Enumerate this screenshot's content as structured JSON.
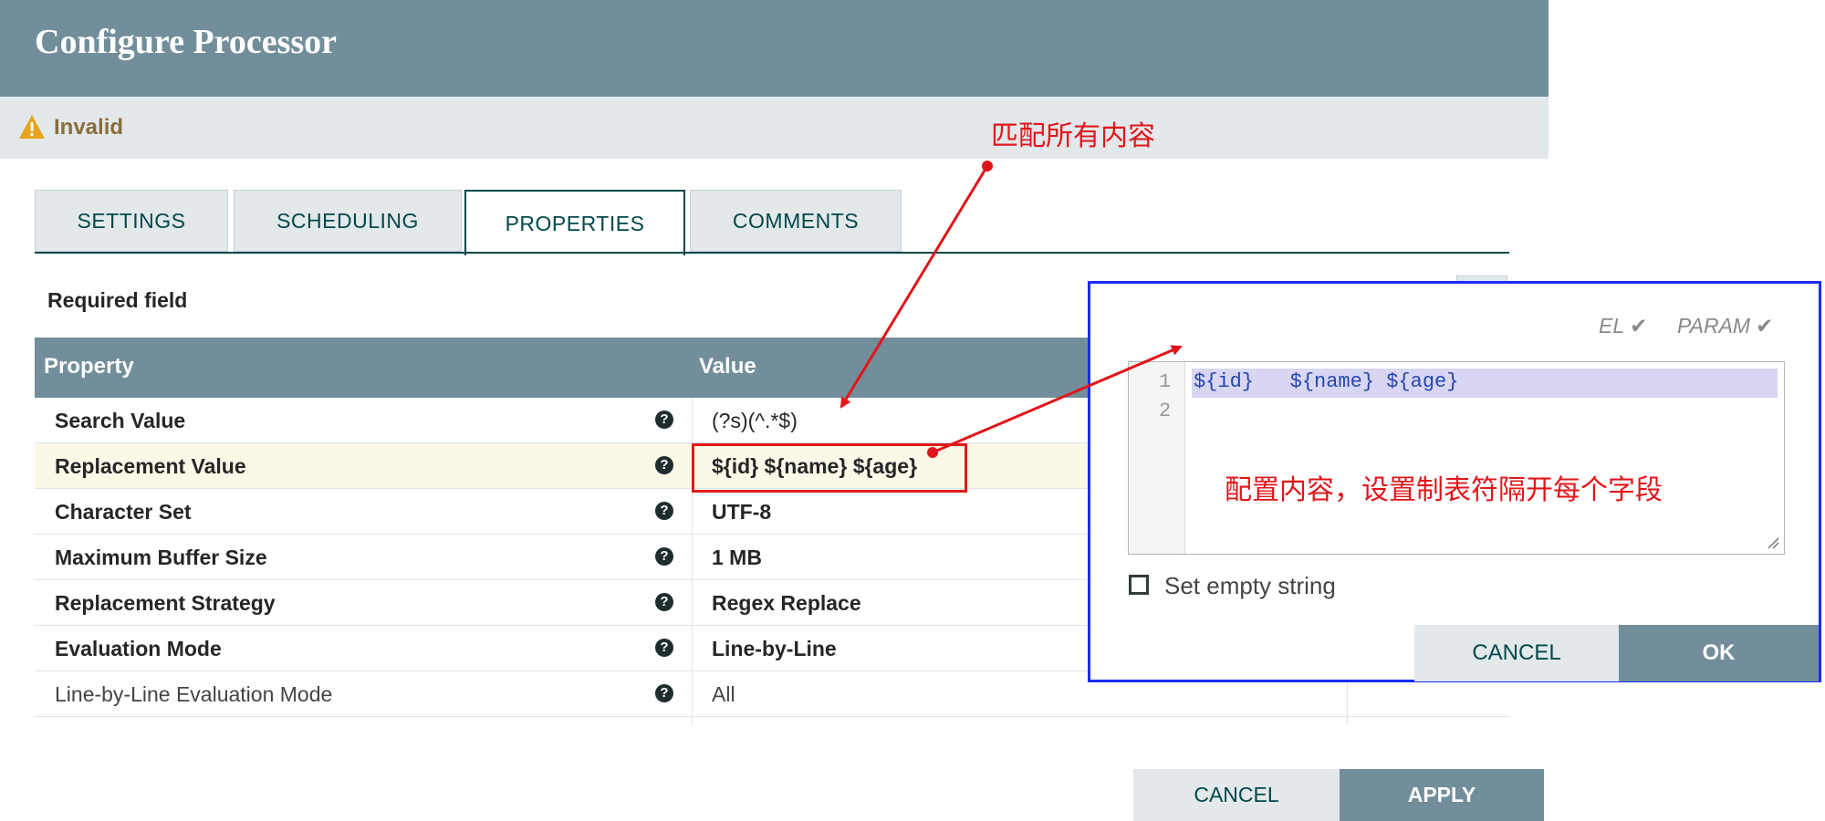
{
  "dialog": {
    "title": "Configure Processor",
    "status": "Invalid"
  },
  "tabs": [
    {
      "label": "SETTINGS",
      "active": false
    },
    {
      "label": "SCHEDULING",
      "active": false
    },
    {
      "label": "PROPERTIES",
      "active": true
    },
    {
      "label": "COMMENTS",
      "active": false
    }
  ],
  "required_field_label": "Required field",
  "table": {
    "headers": {
      "property": "Property",
      "value": "Value"
    },
    "rows": [
      {
        "name": "Search Value",
        "value": "(?s)(^.*$)"
      },
      {
        "name": "Replacement Value",
        "value": "${id} ${name} ${age}"
      },
      {
        "name": "Character Set",
        "value": "UTF-8"
      },
      {
        "name": "Maximum Buffer Size",
        "value": "1 MB"
      },
      {
        "name": "Replacement Strategy",
        "value": "Regex Replace"
      },
      {
        "name": "Evaluation Mode",
        "value": "Line-by-Line"
      },
      {
        "name": "Line-by-Line Evaluation Mode",
        "value": "All"
      }
    ],
    "help_glyph": "?"
  },
  "buttons": {
    "cancel": "CANCEL",
    "apply": "APPLY"
  },
  "editor_popup": {
    "el_flag": "EL",
    "param_flag": "PARAM",
    "check_glyph": "✔",
    "line_numbers": [
      "1",
      "2"
    ],
    "code_line1": "${id}   ${name} ${age}",
    "set_empty_label": "Set empty string",
    "cancel": "CANCEL",
    "ok": "OK"
  },
  "annotations": {
    "match_all": "匹配所有内容",
    "config_note": "配置内容，设置制表符隔开每个字段"
  },
  "colors": {
    "header": "#728e9b",
    "accent": "#004849",
    "annotation_red": "#e0161b",
    "popup_border": "#1a2cff",
    "warning": "#e8a21c"
  }
}
